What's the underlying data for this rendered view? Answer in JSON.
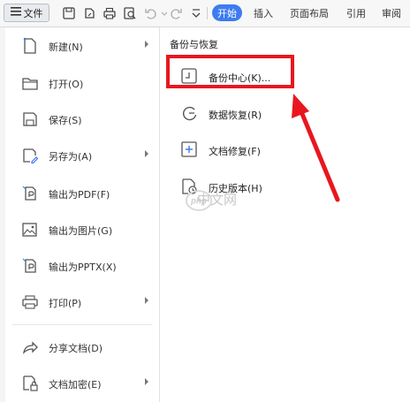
{
  "toolbar": {
    "file_label": "文件",
    "tabs": [
      "开始",
      "插入",
      "页面布局",
      "引用",
      "审阅"
    ],
    "icons": [
      "save-icon",
      "export-icon",
      "print-icon",
      "print-preview-icon",
      "undo-icon",
      "redo-icon",
      "customize-icon"
    ]
  },
  "menu": {
    "items": [
      {
        "label": "新建(N)",
        "icon": "new-doc-icon",
        "submenu": true
      },
      {
        "label": "打开(O)",
        "icon": "folder-icon",
        "submenu": false
      },
      {
        "label": "保存(S)",
        "icon": "save-icon",
        "submenu": false
      },
      {
        "label": "另存为(A)",
        "icon": "save-as-icon",
        "submenu": true
      },
      {
        "label": "输出为PDF(F)",
        "icon": "pdf-icon",
        "submenu": false
      },
      {
        "label": "输出为图片(G)",
        "icon": "image-icon",
        "submenu": false
      },
      {
        "label": "输出为PPTX(X)",
        "icon": "pptx-icon",
        "submenu": false
      },
      {
        "label": "打印(P)",
        "icon": "printer-icon",
        "submenu": true
      },
      {
        "label": "分享文档(D)",
        "icon": "share-icon",
        "submenu": false
      },
      {
        "label": "文档加密(E)",
        "icon": "encrypt-icon",
        "submenu": true
      }
    ]
  },
  "panel": {
    "title": "备份与恢复",
    "items": [
      {
        "label": "备份中心(K)...",
        "icon": "backup-center-icon"
      },
      {
        "label": "数据恢复(R)",
        "icon": "data-recovery-icon"
      },
      {
        "label": "文档修复(F)",
        "icon": "doc-repair-icon"
      },
      {
        "label": "历史版本(H)",
        "icon": "history-icon"
      }
    ]
  },
  "watermark": {
    "text": "中文网",
    "logo": "php"
  },
  "colors": {
    "accent": "#3d7bf0",
    "highlight": "#e8171f"
  }
}
